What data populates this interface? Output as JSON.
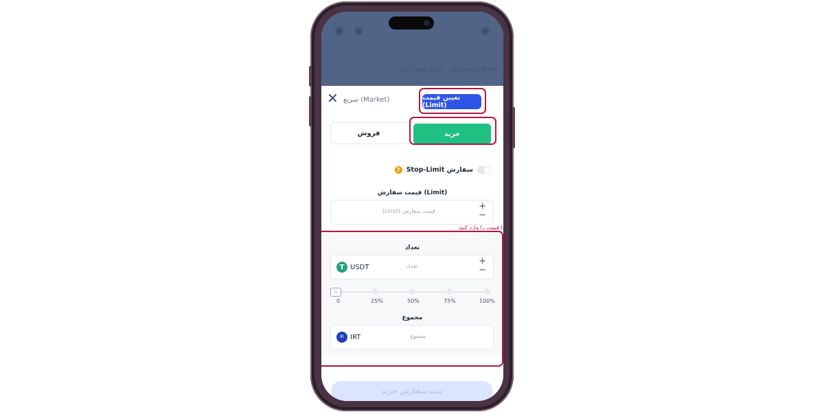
{
  "background_top": {
    "title": "معاملات پیشرفته - خرید سودا عین"
  },
  "order_sheet": {
    "tabs": {
      "market_label": "سریع (Market)",
      "limit_label": "تعیین قیمت (Limit)"
    },
    "side": {
      "buy_label": "خرید",
      "sell_label": "فروش"
    },
    "stop_limit_label": "سفارش Stop-Limit",
    "limit_price": {
      "label": "قیمت سفارش (Limit)",
      "placeholder": "قیمت سفارش (Limit)",
      "error": "ابتدا قیمت را وارد کنید"
    },
    "amount": {
      "label": "تعداد",
      "placeholder": "تعداد",
      "currency": "USDT",
      "currency_icon_text": "T"
    },
    "slider": {
      "ticks": [
        "0",
        "25%",
        "50%",
        "75%",
        "100%"
      ],
      "value_percent": 0
    },
    "total": {
      "label": "مجموع",
      "placeholder": "مجموع",
      "currency": "IRT",
      "currency_icon_text": "IR"
    },
    "submit_label": "ثبت سفارش خرید"
  },
  "colors": {
    "limit_tab": "#2f55e8",
    "buy": "#1fc183",
    "highlight": "#b5153a",
    "usdt": "#26a17b",
    "irt": "#1d3fbb"
  },
  "icons": {
    "close": "close-icon",
    "help": "question-icon",
    "plus": "plus-icon",
    "minus": "minus-icon"
  }
}
